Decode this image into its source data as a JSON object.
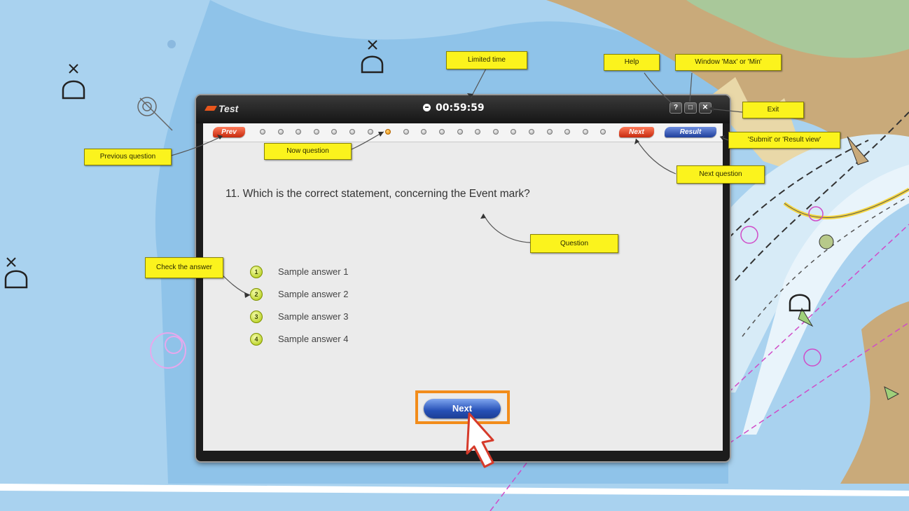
{
  "window": {
    "title": "Test",
    "timer": "00:59:59",
    "help_label": "?",
    "resize_label": "□",
    "close_label": "✕"
  },
  "nav": {
    "prev_label": "Prev",
    "next_label": "Next",
    "result_label": "Result",
    "question_count": 20,
    "current_question": 8
  },
  "question": {
    "text": "11. Which is the correct statement, concerning the Event mark?"
  },
  "answers": [
    {
      "number": "1",
      "label": "Sample answer 1"
    },
    {
      "number": "2",
      "label": "Sample answer 2"
    },
    {
      "number": "3",
      "label": "Sample answer 3"
    },
    {
      "number": "4",
      "label": "Sample answer 4"
    }
  ],
  "main_button": {
    "label": "Next"
  },
  "callouts": {
    "previous_question": "Previous question",
    "now_question": "Now question",
    "limited_time": "Limited time",
    "help": "Help",
    "window_max_min": "Window 'Max' or 'Min'",
    "exit": "Exit",
    "submit_result": "'Submit' or 'Result view'",
    "next_question": "Next question",
    "question": "Question",
    "check_answer": "Check the answer"
  },
  "colors": {
    "callout_yellow": "#fbf31d",
    "highlight_orange": "#f28c1a",
    "next_blue": "#2650b6",
    "nav_red": "#d83a1a",
    "water_light": "#a9d2ef",
    "land_tan": "#c9aa7a"
  }
}
